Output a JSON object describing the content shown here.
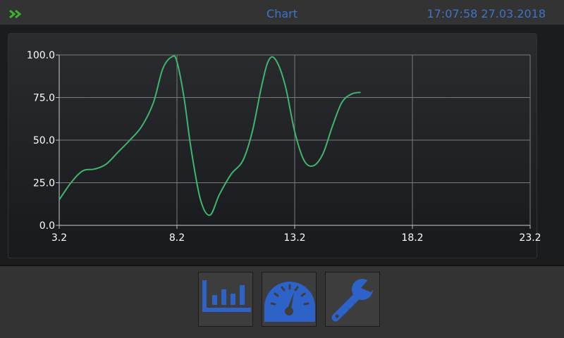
{
  "header": {
    "title": "Chart",
    "datetime": "17:07:58 27.03.2018",
    "menu_icon": "double-chevron-right-icon"
  },
  "colors": {
    "accent": "#3d74c7",
    "line": "#3fb56e",
    "menu_icon": "#3cb32f"
  },
  "chart_data": {
    "type": "line",
    "title": "",
    "xlabel": "",
    "ylabel": "",
    "xlim": [
      3.2,
      23.2
    ],
    "ylim": [
      0,
      100
    ],
    "x_ticks": [
      "3.2",
      "8.2",
      "13.2",
      "18.2",
      "23.2"
    ],
    "y_ticks": [
      "0.0",
      "25.0",
      "50.0",
      "75.0",
      "100.0"
    ],
    "grid": true,
    "series": [
      {
        "x": [
          3.2,
          3.7,
          4.2,
          4.7,
          5.2,
          5.7,
          6.2,
          6.7,
          7.2,
          7.6,
          8.0,
          8.2,
          8.5,
          8.8,
          9.2,
          9.6,
          10.0,
          10.5,
          11.0,
          11.4,
          11.8,
          12.1,
          12.4,
          12.8,
          13.2,
          13.6,
          14.0,
          14.4,
          14.8,
          15.2,
          15.6,
          16.0
        ],
        "y": [
          15,
          25,
          32,
          33,
          36,
          43,
          50,
          58,
          72,
          92,
          99,
          96,
          75,
          45,
          15,
          6,
          18,
          30,
          38,
          55,
          82,
          97,
          97,
          82,
          55,
          38,
          35,
          42,
          58,
          72,
          77,
          78
        ]
      }
    ]
  },
  "nav": {
    "buttons": [
      {
        "icon": "bar-chart-icon"
      },
      {
        "icon": "gauge-icon"
      },
      {
        "icon": "wrench-icon"
      }
    ]
  }
}
